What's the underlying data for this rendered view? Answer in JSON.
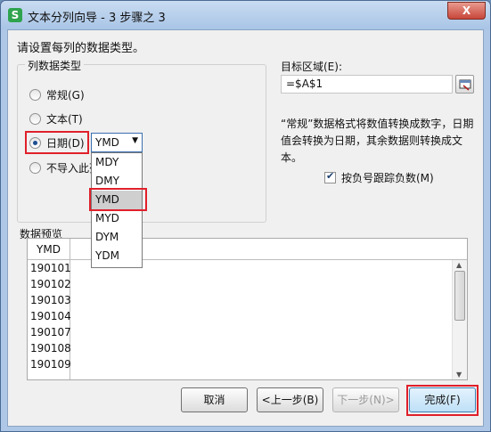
{
  "window": {
    "app_icon_letter": "S",
    "title": "文本分列向导 - 3 步骤之 3",
    "close_symbol": "X"
  },
  "instruction": "请设置每列的数据类型。",
  "column_type_group": {
    "legend": "列数据类型",
    "options": [
      {
        "label": "常规(G)",
        "checked": false
      },
      {
        "label": "文本(T)",
        "checked": false
      },
      {
        "label": "日期(D)",
        "checked": true
      },
      {
        "label": "不导入此列",
        "checked": false
      }
    ],
    "date_format_selected": "YMD",
    "date_format_options": [
      "MDY",
      "DMY",
      "YMD",
      "MYD",
      "DYM",
      "YDM"
    ],
    "date_format_highlighted": "YMD"
  },
  "target": {
    "label": "目标区域(E):",
    "value": "=$A$1"
  },
  "description": "“常规”数据格式将数值转换成数字，日期值会转换为日期，其余数据则转换成文本。",
  "negative_sign_checkbox": {
    "label": "按负号跟踪负数(M)",
    "checked": true
  },
  "preview": {
    "legend": "数据预览",
    "column_header": "YMD",
    "rows": [
      "190101",
      "190102",
      "190103",
      "190104",
      "190107",
      "190108",
      "190109"
    ]
  },
  "buttons": {
    "cancel": "取消",
    "back": "<上一步(B)",
    "next": "下一步(N)>",
    "finish": "完成(F)"
  },
  "colors": {
    "highlight_red": "#e0202a",
    "title_bar": "#aec7e6"
  }
}
